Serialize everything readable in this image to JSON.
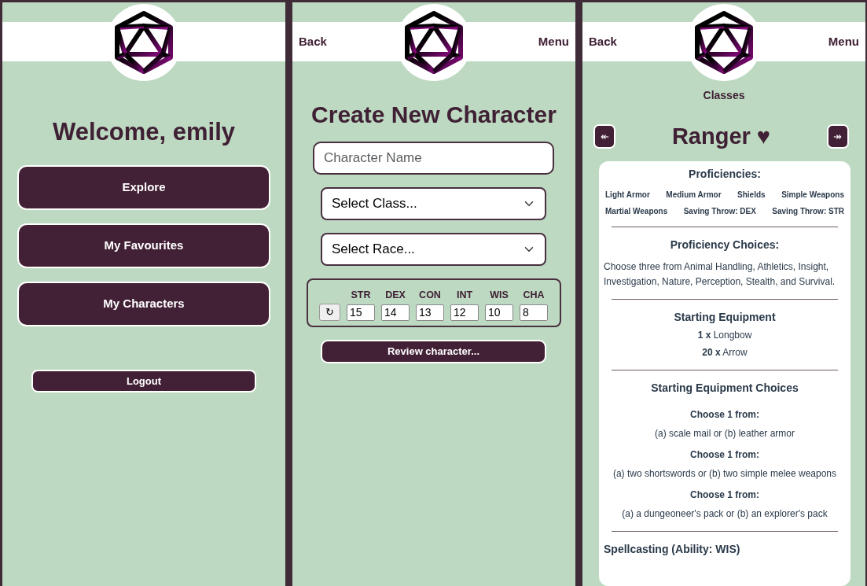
{
  "screens": [
    {
      "kind": "home",
      "title": "Welcome, emily",
      "buttons": [
        "Explore",
        "My Favourites",
        "My Characters"
      ],
      "logout": "Logout"
    },
    {
      "kind": "create",
      "header": {
        "back": "Back",
        "menu": "Menu"
      },
      "title": "Create New Character",
      "name_field": {
        "placeholder": "Character Name"
      },
      "selects": [
        "Select Class...",
        "Select Race..."
      ],
      "reroll": "↻",
      "stats": [
        {
          "label": "STR",
          "value": "15"
        },
        {
          "label": "DEX",
          "value": "14"
        },
        {
          "label": "CON",
          "value": "13"
        },
        {
          "label": "INT",
          "value": "12"
        },
        {
          "label": "WIS",
          "value": "10"
        },
        {
          "label": "CHA",
          "value": "8"
        }
      ],
      "review": "Review character..."
    },
    {
      "kind": "class",
      "header": {
        "back": "Back",
        "menu": "Menu"
      },
      "subtitle": "Classes",
      "prev": "↞",
      "next": "↠",
      "title": "Ranger ♥",
      "proficiencies": {
        "heading": "Proficiencies:",
        "tags": [
          "Light Armor",
          "Medium Armor",
          "Shields",
          "Simple Weapons",
          "Martial Weapons",
          "Saving Throw: DEX",
          "Saving Throw: STR"
        ]
      },
      "proficiency_choices": {
        "heading": "Proficiency Choices:",
        "text": "Choose three from Animal Handling, Athletics, Insight, Investigation, Nature, Perception, Stealth, and Survival."
      },
      "starting_equipment": {
        "heading": "Starting Equipment",
        "items": [
          {
            "qty": "1 x",
            "name": "Longbow"
          },
          {
            "qty": "20 x",
            "name": "Arrow"
          }
        ]
      },
      "equipment_choices": {
        "heading": "Starting Equipment Choices",
        "choices": [
          {
            "label": "Choose 1 from:",
            "options": "(a) scale mail or (b) leather armor"
          },
          {
            "label": "Choose 1 from:",
            "options": "(a) two shortswords or (b) two simple melee weapons"
          },
          {
            "label": "Choose 1 from:",
            "options": "(a) a dungeoneer's pack or (b) an explorer's pack"
          }
        ]
      },
      "spellcasting": {
        "heading": "Spellcasting (Ability: WIS)"
      }
    }
  ]
}
